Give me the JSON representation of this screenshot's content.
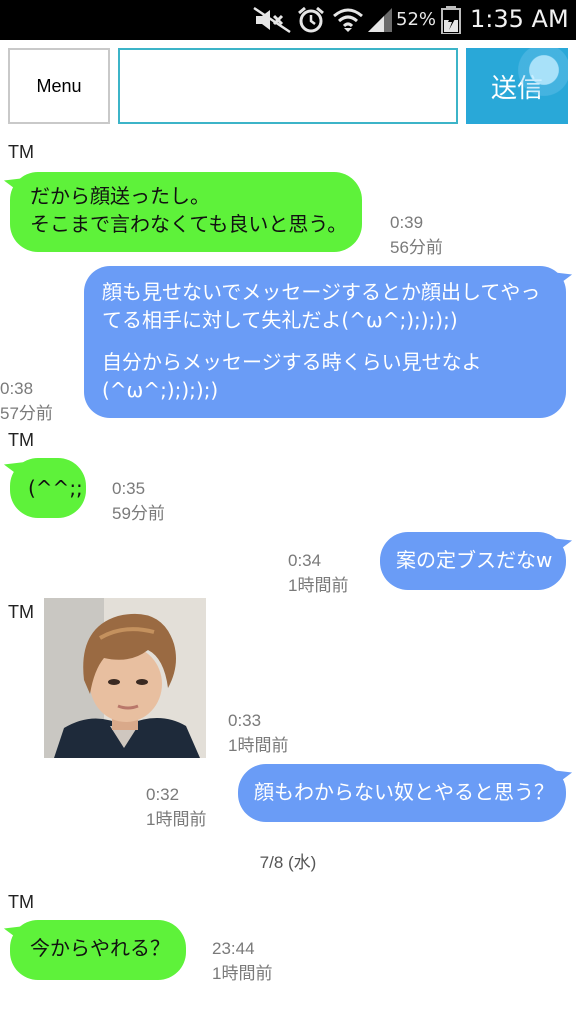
{
  "status_bar": {
    "battery_percent": "52%",
    "time": "1:35 AM",
    "icons": [
      "mute-icon",
      "alarm-icon",
      "wifi-icon",
      "signal-icon",
      "battery-icon"
    ]
  },
  "toolbar": {
    "menu_label": "Menu",
    "input_value": "",
    "send_label": "送信"
  },
  "chat": {
    "messages": [
      {
        "sender": "TM",
        "side": "left",
        "lines": [
          "だから顔送ったし。",
          "そこまで言わなくても良いと思う。"
        ],
        "time": "0:39",
        "ago": "56分前"
      },
      {
        "side": "right",
        "lines": [
          "顔も見せないでメッセージするとか顔出してやっ",
          "てる相手に対して失礼だよ(^ω^;);););)",
          "",
          "自分からメッセージする時くらい見せなよ",
          "(^ω^;);););)"
        ],
        "time": "0:38",
        "ago": "57分前"
      },
      {
        "sender": "TM",
        "side": "left",
        "lines": [
          "(^^;;"
        ],
        "time": "0:35",
        "ago": "59分前"
      },
      {
        "side": "right",
        "lines": [
          "案の定ブスだなw"
        ],
        "time": "0:34",
        "ago": "1時間前"
      },
      {
        "sender": "TM",
        "side": "left",
        "type": "photo",
        "time": "0:33",
        "ago": "1時間前"
      },
      {
        "side": "right",
        "lines": [
          "顔もわからない奴とやると思う？"
        ],
        "time": "0:32",
        "ago": "1時間前"
      },
      {
        "sender": "TM",
        "side": "left",
        "lines": [
          "今からやれる？"
        ],
        "time": "23:44",
        "ago": "1時間前"
      }
    ],
    "date_separator": "7/8 (水)"
  },
  "colors": {
    "incoming_bubble": "#5ef23a",
    "outgoing_bubble": "#6a9cf6",
    "send_button": "#29a8d8",
    "input_border": "#3cb4c8"
  }
}
